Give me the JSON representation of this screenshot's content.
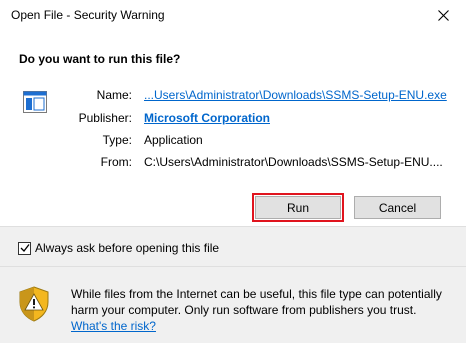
{
  "window": {
    "title": "Open File - Security Warning"
  },
  "dialog": {
    "question": "Do you want to run this file?",
    "fields": [
      {
        "label": "Name:",
        "value": "...Users\\Administrator\\Downloads\\SSMS-Setup-ENU.exe"
      },
      {
        "label": "Publisher:",
        "value": "Microsoft Corporation"
      },
      {
        "label": "Type:",
        "value": "Application"
      },
      {
        "label": "From:",
        "value": "C:\\Users\\Administrator\\Downloads\\SSMS-Setup-ENU...."
      }
    ],
    "buttons": {
      "run": "Run",
      "cancel": "Cancel"
    },
    "checkbox": {
      "label": "Always ask before opening this file",
      "checked": true
    },
    "warning": {
      "text": "While files from the Internet can be useful, this file type can potentially harm your computer. Only run software from publishers you trust.",
      "link": "What's the risk?"
    }
  },
  "icons": {
    "close": "close-icon",
    "app": "application-icon",
    "shield": "security-shield-icon",
    "check": "checkmark-icon"
  },
  "colors": {
    "link": "#0066cc",
    "highlight": "#e0141e",
    "footer_bg": "#f0f0f0"
  }
}
